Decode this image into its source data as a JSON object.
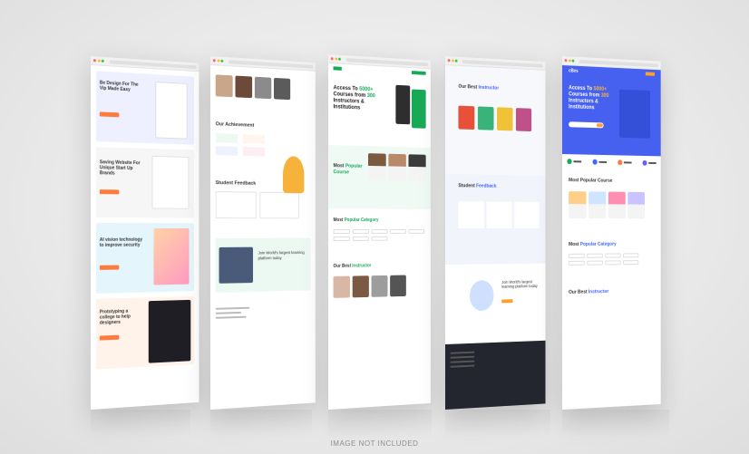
{
  "caption": "IMAGE NOT INCLUDED",
  "panel1": {
    "h1": "Be Design For The Vip Made Easy",
    "h2": "Saving Website For Unique Start Up Brands",
    "h3": "AI vision technology to improve security",
    "h4": "Prototyping a college to help designers"
  },
  "panel2": {
    "achievement_heading": "Our Achievement",
    "feedback_heading": "Student Feedback",
    "cta_heading": "Join World's largest learning platform today"
  },
  "panel3": {
    "hero_prefix": "Access To ",
    "hero_highlight1": "5000+",
    "hero_mid": " Courses from ",
    "hero_highlight2": "300",
    "hero_tail": " Instructors & Institutions",
    "popular_prefix": "Most ",
    "popular_highlight": "Popular Course",
    "category_prefix": "Most ",
    "category_highlight": "Popular Category",
    "instructor_prefix": "Our Best ",
    "instructor_highlight": "Instructor"
  },
  "panel4": {
    "instructor_prefix": "Our Best ",
    "instructor_highlight": "Instructor",
    "feedback_prefix": "Student ",
    "feedback_highlight": "Feedback",
    "cta_heading": "Join World's largest learning platform today"
  },
  "panel5": {
    "logo": "cBes",
    "hero_prefix": "Access To ",
    "hero_highlight1": "5000+",
    "hero_mid": " Courses from ",
    "hero_highlight2": "300",
    "hero_tail": " Instructors & Institutions",
    "popular_heading": "Most Popular Course",
    "category_prefix": "Most ",
    "category_highlight": "Popular Category",
    "instructor_prefix": "Our Best ",
    "instructor_highlight": "Instructor"
  },
  "colors": {
    "accent_green": "#18a957",
    "accent_blue": "#3c66ff",
    "accent_orange": "#ff7a3d"
  }
}
